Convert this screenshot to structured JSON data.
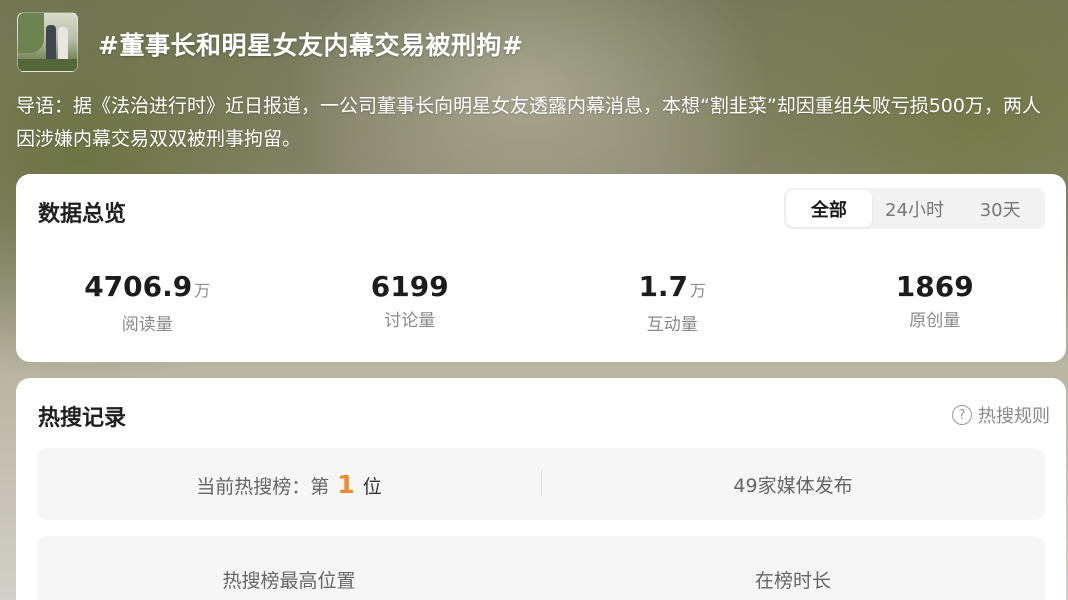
{
  "header": {
    "title": "#董事长和明星女友内幕交易被刑拘#",
    "guide": "导语：据《法治进行时》近日报道，一公司董事长向明星女友透露内幕消息，本想“割韭菜”却因重组失败亏损500万，两人因涉嫌内幕交易双双被刑事拘留。"
  },
  "overview": {
    "title": "数据总览",
    "tabs": [
      "全部",
      "24小时",
      "30天"
    ],
    "active_tab": "全部",
    "stats": [
      {
        "value": "4706.9",
        "unit": "万",
        "label": "阅读量"
      },
      {
        "value": "6199",
        "unit": "",
        "label": "讨论量"
      },
      {
        "value": "1.7",
        "unit": "万",
        "label": "互动量"
      },
      {
        "value": "1869",
        "unit": "",
        "label": "原创量"
      }
    ]
  },
  "hot": {
    "title": "热搜记录",
    "rules_label": "热搜规则",
    "rank_prefix": "当前热搜榜：第",
    "rank_value": "1",
    "rank_suffix": "位",
    "media_label": "49家媒体发布",
    "peak_label": "热搜榜最高位置",
    "duration_label": "在榜时长"
  },
  "colors": {
    "accent": "#f08a2a",
    "text_primary": "#1f1f1f",
    "text_secondary": "#8a8a8a"
  }
}
